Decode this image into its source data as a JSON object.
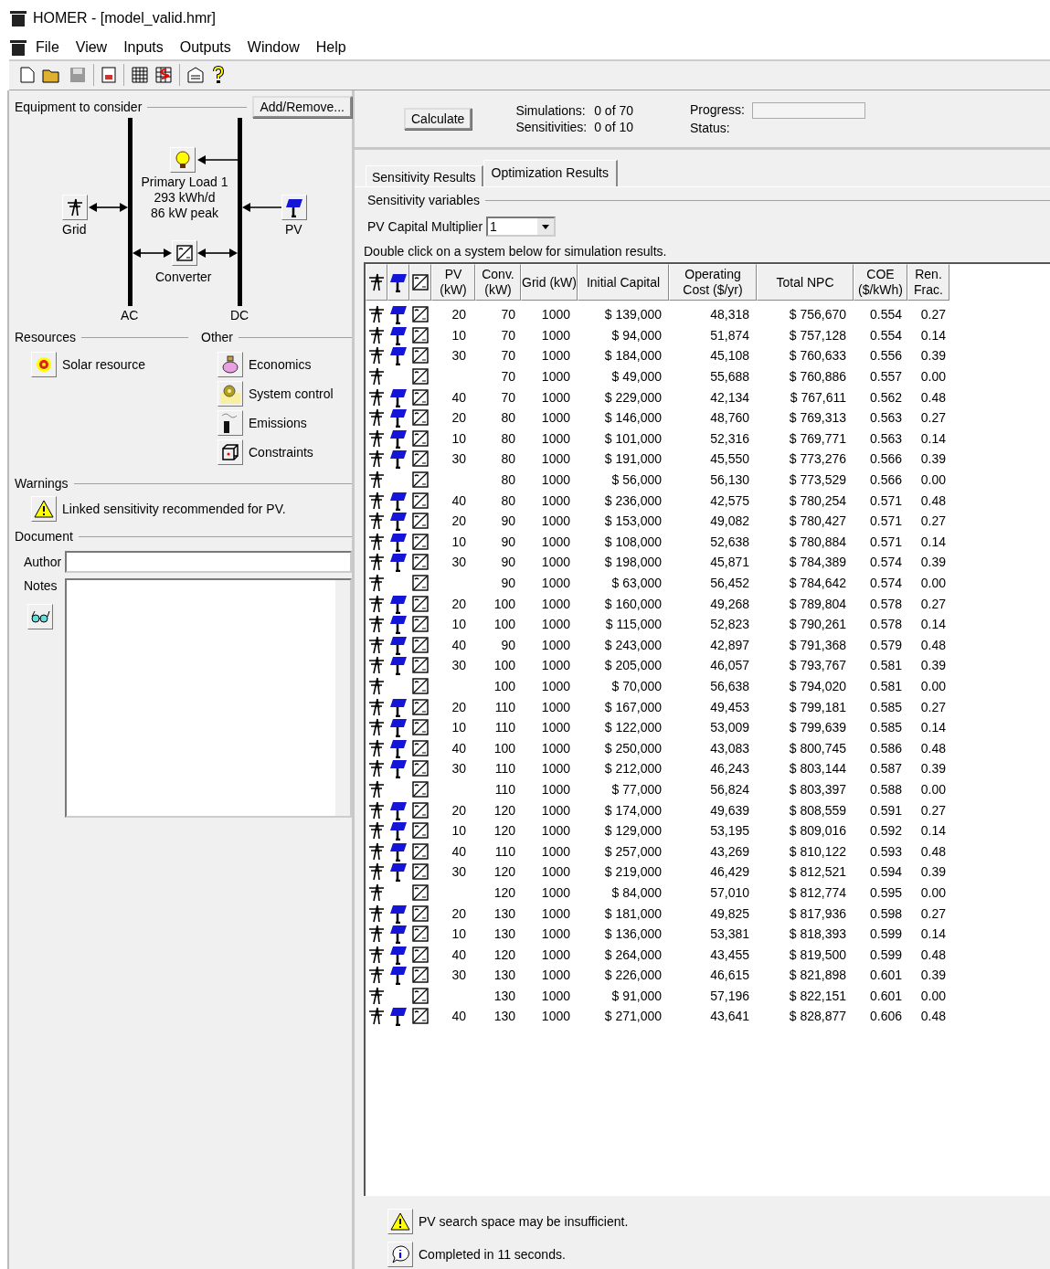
{
  "window": {
    "title": "HOMER - [model_valid.hmr]"
  },
  "menu": [
    "File",
    "View",
    "Inputs",
    "Outputs",
    "Window",
    "Help"
  ],
  "equipment": {
    "title": "Equipment to consider",
    "add_button": "Add/Remove...",
    "load": {
      "name": "Primary Load 1",
      "energy": "293 kWh/d",
      "peak": "86 kW peak"
    },
    "grid": "Grid",
    "pv": "PV",
    "converter": "Converter",
    "ac": "AC",
    "dc": "DC"
  },
  "resources": {
    "title": "Resources",
    "items": [
      "Solar resource"
    ]
  },
  "other": {
    "title": "Other",
    "items": [
      {
        "kind": "economics",
        "label": "Economics"
      },
      {
        "kind": "control",
        "label": "System control"
      },
      {
        "kind": "emissions",
        "label": "Emissions"
      },
      {
        "kind": "constraints",
        "label": "Constraints"
      }
    ]
  },
  "warnings": {
    "title": "Warnings",
    "items": [
      "Linked sensitivity recommended for PV."
    ]
  },
  "document": {
    "title": "Document",
    "author_label": "Author",
    "notes_label": "Notes"
  },
  "calculate": {
    "button": "Calculate",
    "simulations_label": "Simulations:",
    "simulations": "0 of 70",
    "sensitivities_label": "Sensitivities:",
    "sensitivities": "0 of 10",
    "progress_label": "Progress:",
    "progress_bar": {
      "level": 0
    },
    "status_label": "Status:"
  },
  "tabs": [
    {
      "label": "Sensitivity Results",
      "selected": false
    },
    {
      "label": "Optimization Results",
      "selected": true
    }
  ],
  "sensitivity": {
    "title": "Sensitivity variables",
    "label": "PV Capital Multiplier",
    "value": "1"
  },
  "hint": "Double click on a system below for simulation results.",
  "table": {
    "columns": [
      "PV (kW)",
      "Conv. (kW)",
      "Grid (kW)",
      "Initial Capital",
      "Operating Cost ($/yr)",
      "Total NPC",
      "COE ($/kWh)",
      "Ren. Frac."
    ],
    "rows": [
      {
        "has_pv": true,
        "pv": "20",
        "conv": "70",
        "grid": "1000",
        "capital": "$ 139,000",
        "opcost": "48,318",
        "npc": "$ 756,670",
        "coe": "0.554",
        "ren": "0.27"
      },
      {
        "has_pv": true,
        "pv": "10",
        "conv": "70",
        "grid": "1000",
        "capital": "$ 94,000",
        "opcost": "51,874",
        "npc": "$ 757,128",
        "coe": "0.554",
        "ren": "0.14"
      },
      {
        "has_pv": true,
        "pv": "30",
        "conv": "70",
        "grid": "1000",
        "capital": "$ 184,000",
        "opcost": "45,108",
        "npc": "$ 760,633",
        "coe": "0.556",
        "ren": "0.39"
      },
      {
        "has_pv": false,
        "conv": "70",
        "grid": "1000",
        "capital": "$ 49,000",
        "opcost": "55,688",
        "npc": "$ 760,886",
        "coe": "0.557",
        "ren": "0.00"
      },
      {
        "has_pv": true,
        "pv": "40",
        "conv": "70",
        "grid": "1000",
        "capital": "$ 229,000",
        "opcost": "42,134",
        "npc": "$ 767,611",
        "coe": "0.562",
        "ren": "0.48"
      },
      {
        "has_pv": true,
        "pv": "20",
        "conv": "80",
        "grid": "1000",
        "capital": "$ 146,000",
        "opcost": "48,760",
        "npc": "$ 769,313",
        "coe": "0.563",
        "ren": "0.27"
      },
      {
        "has_pv": true,
        "pv": "10",
        "conv": "80",
        "grid": "1000",
        "capital": "$ 101,000",
        "opcost": "52,316",
        "npc": "$ 769,771",
        "coe": "0.563",
        "ren": "0.14"
      },
      {
        "has_pv": true,
        "pv": "30",
        "conv": "80",
        "grid": "1000",
        "capital": "$ 191,000",
        "opcost": "45,550",
        "npc": "$ 773,276",
        "coe": "0.566",
        "ren": "0.39"
      },
      {
        "has_pv": false,
        "conv": "80",
        "grid": "1000",
        "capital": "$ 56,000",
        "opcost": "56,130",
        "npc": "$ 773,529",
        "coe": "0.566",
        "ren": "0.00"
      },
      {
        "has_pv": true,
        "pv": "40",
        "conv": "80",
        "grid": "1000",
        "capital": "$ 236,000",
        "opcost": "42,575",
        "npc": "$ 780,254",
        "coe": "0.571",
        "ren": "0.48"
      },
      {
        "has_pv": true,
        "pv": "20",
        "conv": "90",
        "grid": "1000",
        "capital": "$ 153,000",
        "opcost": "49,082",
        "npc": "$ 780,427",
        "coe": "0.571",
        "ren": "0.27"
      },
      {
        "has_pv": true,
        "pv": "10",
        "conv": "90",
        "grid": "1000",
        "capital": "$ 108,000",
        "opcost": "52,638",
        "npc": "$ 780,884",
        "coe": "0.571",
        "ren": "0.14"
      },
      {
        "has_pv": true,
        "pv": "30",
        "conv": "90",
        "grid": "1000",
        "capital": "$ 198,000",
        "opcost": "45,871",
        "npc": "$ 784,389",
        "coe": "0.574",
        "ren": "0.39"
      },
      {
        "has_pv": false,
        "conv": "90",
        "grid": "1000",
        "capital": "$ 63,000",
        "opcost": "56,452",
        "npc": "$ 784,642",
        "coe": "0.574",
        "ren": "0.00"
      },
      {
        "has_pv": true,
        "pv": "20",
        "conv": "100",
        "grid": "1000",
        "capital": "$ 160,000",
        "opcost": "49,268",
        "npc": "$ 789,804",
        "coe": "0.578",
        "ren": "0.27"
      },
      {
        "has_pv": true,
        "pv": "10",
        "conv": "100",
        "grid": "1000",
        "capital": "$ 115,000",
        "opcost": "52,823",
        "npc": "$ 790,261",
        "coe": "0.578",
        "ren": "0.14"
      },
      {
        "has_pv": true,
        "pv": "40",
        "conv": "90",
        "grid": "1000",
        "capital": "$ 243,000",
        "opcost": "42,897",
        "npc": "$ 791,368",
        "coe": "0.579",
        "ren": "0.48"
      },
      {
        "has_pv": true,
        "pv": "30",
        "conv": "100",
        "grid": "1000",
        "capital": "$ 205,000",
        "opcost": "46,057",
        "npc": "$ 793,767",
        "coe": "0.581",
        "ren": "0.39"
      },
      {
        "has_pv": false,
        "conv": "100",
        "grid": "1000",
        "capital": "$ 70,000",
        "opcost": "56,638",
        "npc": "$ 794,020",
        "coe": "0.581",
        "ren": "0.00"
      },
      {
        "has_pv": true,
        "pv": "20",
        "conv": "110",
        "grid": "1000",
        "capital": "$ 167,000",
        "opcost": "49,453",
        "npc": "$ 799,181",
        "coe": "0.585",
        "ren": "0.27"
      },
      {
        "has_pv": true,
        "pv": "10",
        "conv": "110",
        "grid": "1000",
        "capital": "$ 122,000",
        "opcost": "53,009",
        "npc": "$ 799,639",
        "coe": "0.585",
        "ren": "0.14"
      },
      {
        "has_pv": true,
        "pv": "40",
        "conv": "100",
        "grid": "1000",
        "capital": "$ 250,000",
        "opcost": "43,083",
        "npc": "$ 800,745",
        "coe": "0.586",
        "ren": "0.48"
      },
      {
        "has_pv": true,
        "pv": "30",
        "conv": "110",
        "grid": "1000",
        "capital": "$ 212,000",
        "opcost": "46,243",
        "npc": "$ 803,144",
        "coe": "0.587",
        "ren": "0.39"
      },
      {
        "has_pv": false,
        "conv": "110",
        "grid": "1000",
        "capital": "$ 77,000",
        "opcost": "56,824",
        "npc": "$ 803,397",
        "coe": "0.588",
        "ren": "0.00"
      },
      {
        "has_pv": true,
        "pv": "20",
        "conv": "120",
        "grid": "1000",
        "capital": "$ 174,000",
        "opcost": "49,639",
        "npc": "$ 808,559",
        "coe": "0.591",
        "ren": "0.27"
      },
      {
        "has_pv": true,
        "pv": "10",
        "conv": "120",
        "grid": "1000",
        "capital": "$ 129,000",
        "opcost": "53,195",
        "npc": "$ 809,016",
        "coe": "0.592",
        "ren": "0.14"
      },
      {
        "has_pv": true,
        "pv": "40",
        "conv": "110",
        "grid": "1000",
        "capital": "$ 257,000",
        "opcost": "43,269",
        "npc": "$ 810,122",
        "coe": "0.593",
        "ren": "0.48"
      },
      {
        "has_pv": true,
        "pv": "30",
        "conv": "120",
        "grid": "1000",
        "capital": "$ 219,000",
        "opcost": "46,429",
        "npc": "$ 812,521",
        "coe": "0.594",
        "ren": "0.39"
      },
      {
        "has_pv": false,
        "conv": "120",
        "grid": "1000",
        "capital": "$ 84,000",
        "opcost": "57,010",
        "npc": "$ 812,774",
        "coe": "0.595",
        "ren": "0.00"
      },
      {
        "has_pv": true,
        "pv": "20",
        "conv": "130",
        "grid": "1000",
        "capital": "$ 181,000",
        "opcost": "49,825",
        "npc": "$ 817,936",
        "coe": "0.598",
        "ren": "0.27"
      },
      {
        "has_pv": true,
        "pv": "10",
        "conv": "130",
        "grid": "1000",
        "capital": "$ 136,000",
        "opcost": "53,381",
        "npc": "$ 818,393",
        "coe": "0.599",
        "ren": "0.14"
      },
      {
        "has_pv": true,
        "pv": "40",
        "conv": "120",
        "grid": "1000",
        "capital": "$ 264,000",
        "opcost": "43,455",
        "npc": "$ 819,500",
        "coe": "0.599",
        "ren": "0.48"
      },
      {
        "has_pv": true,
        "pv": "30",
        "conv": "130",
        "grid": "1000",
        "capital": "$ 226,000",
        "opcost": "46,615",
        "npc": "$ 821,898",
        "coe": "0.601",
        "ren": "0.39"
      },
      {
        "has_pv": false,
        "conv": "130",
        "grid": "1000",
        "capital": "$ 91,000",
        "opcost": "57,196",
        "npc": "$ 822,151",
        "coe": "0.601",
        "ren": "0.00"
      },
      {
        "has_pv": true,
        "pv": "40",
        "conv": "130",
        "grid": "1000",
        "capital": "$ 271,000",
        "opcost": "43,641",
        "npc": "$ 828,877",
        "coe": "0.606",
        "ren": "0.48"
      }
    ]
  },
  "messages": [
    {
      "kind": "warning",
      "text": "PV search space may be insufficient."
    },
    {
      "kind": "info",
      "text": "Completed in 11 seconds."
    }
  ]
}
